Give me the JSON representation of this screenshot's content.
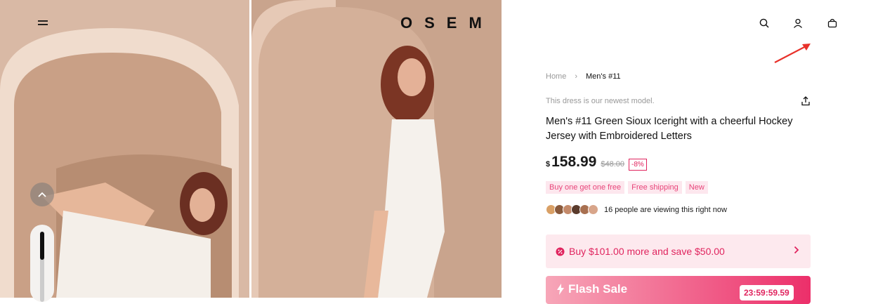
{
  "header": {
    "logo": "OSEM",
    "icons": [
      "menu-icon",
      "search-icon",
      "account-icon",
      "bag-icon"
    ]
  },
  "breadcrumb": {
    "home": "Home",
    "separator": "›",
    "current": "Men's #11"
  },
  "product": {
    "note": "This dress is our newest model.",
    "title": "Men's #11 Green Sioux Iceright with a cheerful Hockey Jersey with Embroidered Letters",
    "currency": "$",
    "price": "158.99",
    "old_price": "$48.00",
    "discount": "-8%",
    "tags": [
      "Buy one get one free",
      "Free shipping",
      "New"
    ],
    "viewers": "16 people are viewing this right now"
  },
  "offer": {
    "text": "Buy $101.00 more and save $50.00"
  },
  "flash_sale": {
    "label": "Flash Sale",
    "timer": "23:59:59.59"
  },
  "gallery": {
    "scroll_progress": 0.4
  },
  "colors": {
    "accent": "#e0245e",
    "tag_bg": "#fde7ee",
    "offer_bg": "#fde9ee"
  }
}
